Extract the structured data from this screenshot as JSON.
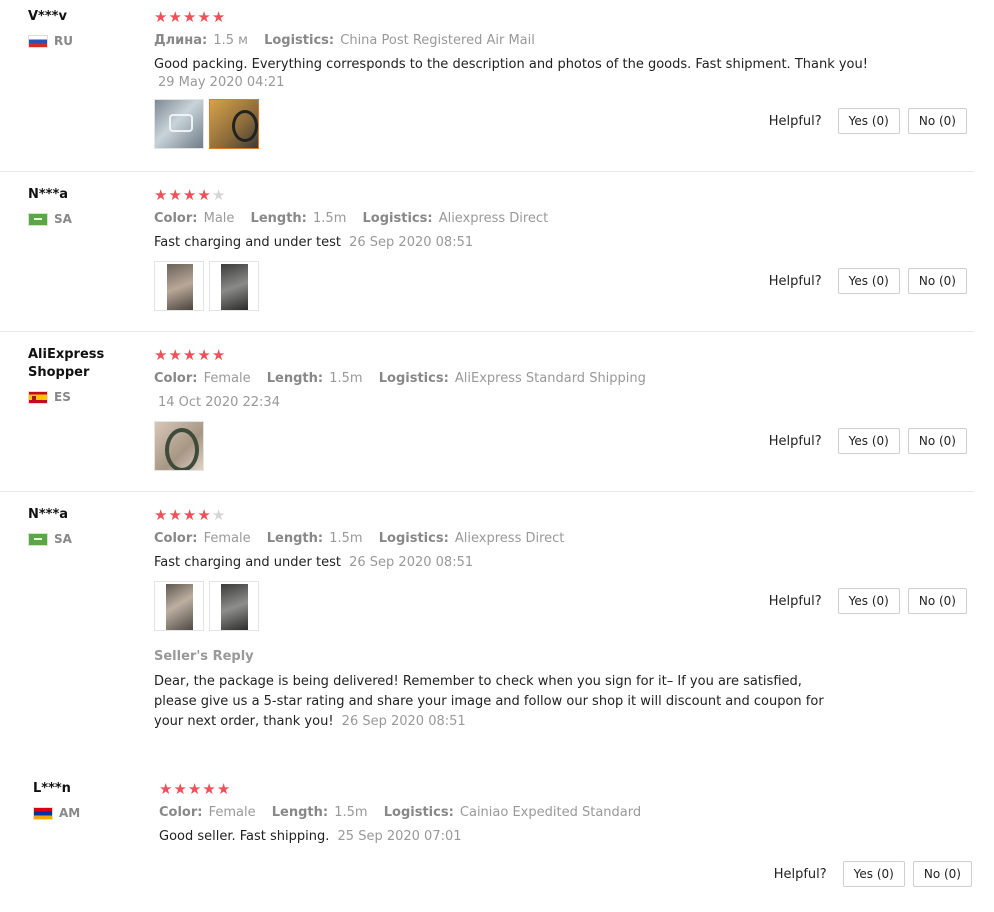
{
  "reviews": [
    {
      "user": "V***v",
      "country": "RU",
      "attrs": [
        {
          "key": "Длина:",
          "value": "1.5 м"
        },
        {
          "key": "Logistics:",
          "value": "China Post Registered Air Mail"
        }
      ],
      "text": "Good packing. Everything corresponds to the description and photos of the goods. Fast shipment. Thank you!",
      "date": "29 May 2020 04:21",
      "helpful_label": "Helpful?",
      "yes_label": "Yes (0)",
      "no_label": "No (0)"
    },
    {
      "user": "N***a",
      "country": "SA",
      "attrs": [
        {
          "key": "Color:",
          "value": "Male"
        },
        {
          "key": "Length:",
          "value": "1.5m"
        },
        {
          "key": "Logistics:",
          "value": "Aliexpress Direct"
        }
      ],
      "text": "Fast charging and under test",
      "date": "26 Sep 2020 08:51",
      "helpful_label": "Helpful?",
      "yes_label": "Yes (0)",
      "no_label": "No (0)"
    },
    {
      "user": "AliExpress Shopper",
      "country": "ES",
      "attrs": [
        {
          "key": "Color:",
          "value": "Female"
        },
        {
          "key": "Length:",
          "value": "1.5m"
        },
        {
          "key": "Logistics:",
          "value": "AliExpress Standard Shipping"
        }
      ],
      "text": "",
      "date": "14 Oct 2020 22:34",
      "helpful_label": "Helpful?",
      "yes_label": "Yes (0)",
      "no_label": "No (0)"
    },
    {
      "user": "N***a",
      "country": "SA",
      "attrs": [
        {
          "key": "Color:",
          "value": "Female"
        },
        {
          "key": "Length:",
          "value": "1.5m"
        },
        {
          "key": "Logistics:",
          "value": "Aliexpress Direct"
        }
      ],
      "text": "Fast charging and under test",
      "date": "26 Sep 2020 08:51",
      "seller_reply_title": "Seller's Reply",
      "seller_reply_text": "Dear, the package is being delivered! Remember to check when you sign for it– If you are satisfied, please give us a 5-star rating and share your image and follow our shop it will discount and coupon for your next order, thank you!",
      "seller_reply_date": "26 Sep 2020 08:51",
      "helpful_label": "Helpful?",
      "yes_label": "Yes (0)",
      "no_label": "No (0)"
    },
    {
      "user": "L***n",
      "country": "AM",
      "attrs": [
        {
          "key": "Color:",
          "value": "Female"
        },
        {
          "key": "Length:",
          "value": "1.5m"
        },
        {
          "key": "Logistics:",
          "value": "Cainiao Expedited Standard"
        }
      ],
      "text": "Good seller. Fast shipping.",
      "date": "25 Sep 2020 07:01",
      "helpful_label": "Helpful?",
      "yes_label": "Yes (0)",
      "no_label": "No (0)"
    }
  ],
  "ratings": [
    5,
    4,
    5,
    4,
    5
  ],
  "colors": {
    "star": "#f0505a",
    "star_off": "#d6d6d6",
    "muted": "#999999"
  }
}
